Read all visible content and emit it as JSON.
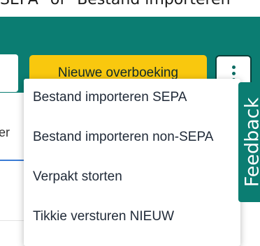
{
  "caption": {
    "text": "SEPA\" of \"Bestand importeren"
  },
  "header": {
    "new_transfer_label": "Nieuwe overboeking",
    "more_button_icon": "more-vertical-icon",
    "accent_color": "#0b7d72",
    "button_color": "#f9c80e"
  },
  "left_panel": {
    "fragment": "er"
  },
  "menu": {
    "items": [
      {
        "label": "Bestand importeren SEPA"
      },
      {
        "label": "Bestand importeren non-SEPA"
      },
      {
        "label": "Verpakt storten"
      },
      {
        "label": "Tikkie versturen NIEUW"
      }
    ]
  },
  "feedback": {
    "label": "Feedback"
  }
}
